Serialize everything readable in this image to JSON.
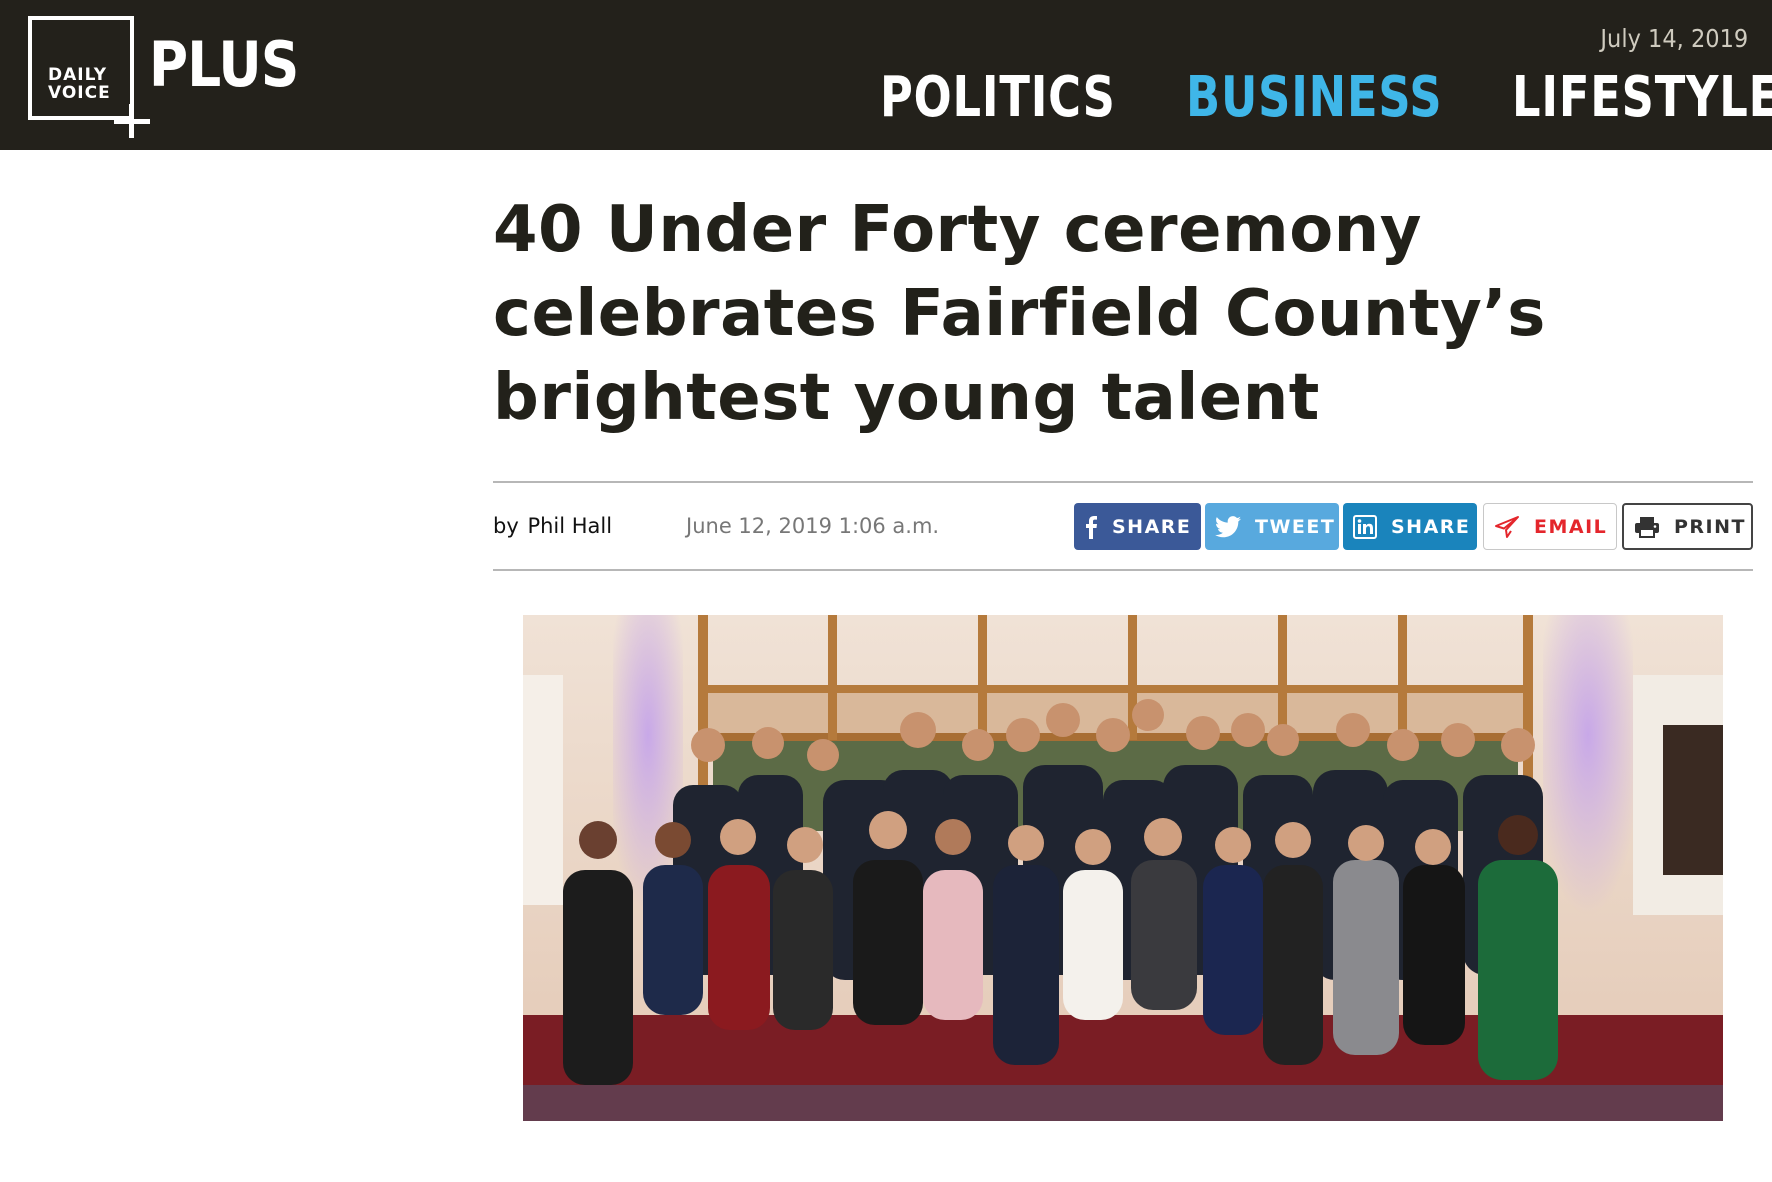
{
  "header": {
    "logo": {
      "line1": "DAILY",
      "line2": "VOICE",
      "word": "PLUS"
    },
    "date": "July 14, 2019",
    "nav": [
      {
        "label": "POLITICS",
        "active": false
      },
      {
        "label": "BUSINESS",
        "active": true
      },
      {
        "label": "LIFESTYLE",
        "active": false
      }
    ]
  },
  "article": {
    "headline": "40 Under Forty ceremony celebrates Fairfield County’s brightest young talent",
    "byline_prefix": "by",
    "author": "Phil Hall",
    "published": "June 12, 2019 1:06 a.m."
  },
  "share_buttons": [
    {
      "label": "SHARE",
      "icon": "facebook-icon",
      "color": "#3b5998"
    },
    {
      "label": "TWEET",
      "icon": "twitter-icon",
      "color": "#58a9de"
    },
    {
      "label": "SHARE",
      "icon": "linkedin-icon",
      "color": "#1a84bc"
    },
    {
      "label": "EMAIL",
      "icon": "paper-plane-icon",
      "color": "#e4262c"
    },
    {
      "label": "PRINT",
      "icon": "printer-icon",
      "color": "#333333"
    }
  ],
  "colors": {
    "header_bg": "#23211b",
    "accent": "#3fb6e8",
    "text": "#22211a"
  }
}
